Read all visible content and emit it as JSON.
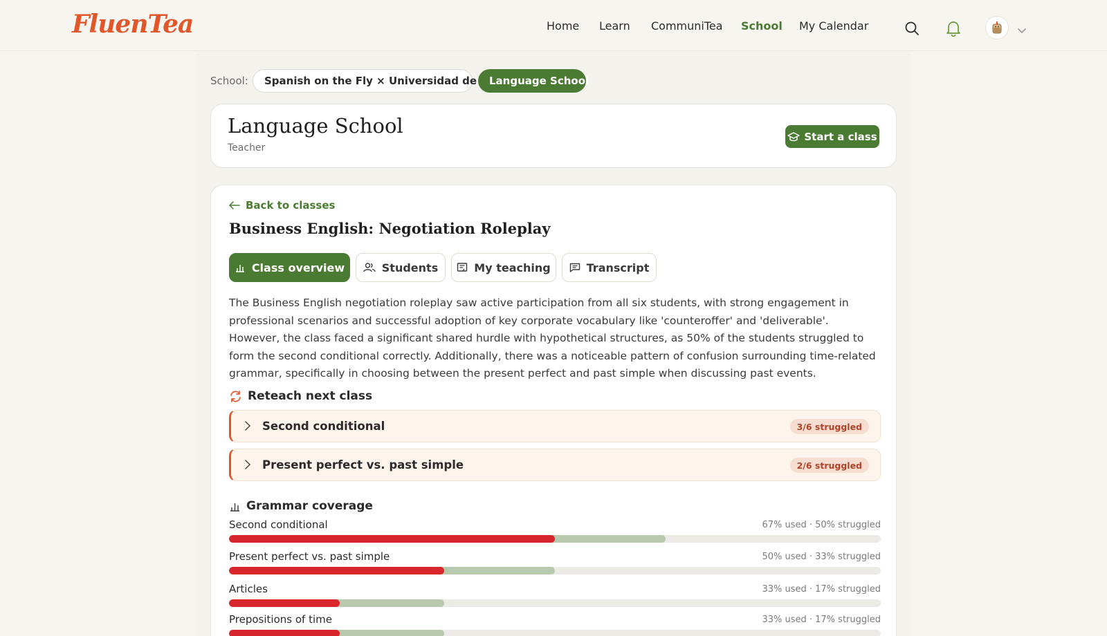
{
  "brand": {
    "logo": "FluenTea",
    "accent": "#e0572c",
    "green": "#4b7a32"
  },
  "nav": {
    "items": [
      {
        "label": "Home"
      },
      {
        "label": "Learn"
      },
      {
        "label": "CommuniTea"
      },
      {
        "label": "School",
        "active": true
      },
      {
        "label": "My Calendar"
      }
    ]
  },
  "school_bar": {
    "label": "School:",
    "schools": [
      {
        "label": "Spanish on the Fly × Universidad de G…",
        "selected": false
      },
      {
        "label": "Language School",
        "selected": true
      }
    ]
  },
  "header": {
    "title": "Language School",
    "role": "Teacher",
    "start_class_label": "Start a class"
  },
  "class": {
    "back_label": "Back to classes",
    "title": "Business English: Negotiation Roleplay",
    "tabs": [
      {
        "label": "Class overview",
        "active": true
      },
      {
        "label": "Students"
      },
      {
        "label": "My teaching"
      },
      {
        "label": "Transcript"
      }
    ],
    "summary": "The Business English negotiation roleplay saw active participation from all six students, with strong engagement in professional scenarios and successful adoption of key corporate vocabulary like 'counteroffer' and 'deliverable'. However, the class faced a significant shared hurdle with hypothetical structures, as 50% of the students struggled to form the second conditional correctly. Additionally, there was a noticeable pattern of confusion surrounding time-related grammar, specifically in choosing between the present perfect and past simple when discussing past events.",
    "reteach": {
      "heading": "Reteach next class",
      "items": [
        {
          "label": "Second conditional",
          "badge": "3/6 struggled"
        },
        {
          "label": "Present perfect vs. past simple",
          "badge": "2/6 struggled"
        }
      ]
    },
    "grammar": {
      "heading": "Grammar coverage",
      "items": [
        {
          "label": "Second conditional",
          "stats": "67% used · 50% struggled",
          "used": 0.67,
          "struggled": 0.5
        },
        {
          "label": "Present perfect vs. past simple",
          "stats": "50% used · 33% struggled",
          "used": 0.5,
          "struggled": 0.33
        },
        {
          "label": "Articles",
          "stats": "33% used · 17% struggled",
          "used": 0.33,
          "struggled": 0.17
        },
        {
          "label": "Prepositions of time",
          "stats": "33% used · 17% struggled",
          "used": 0.33,
          "struggled": 0.17
        }
      ]
    }
  }
}
